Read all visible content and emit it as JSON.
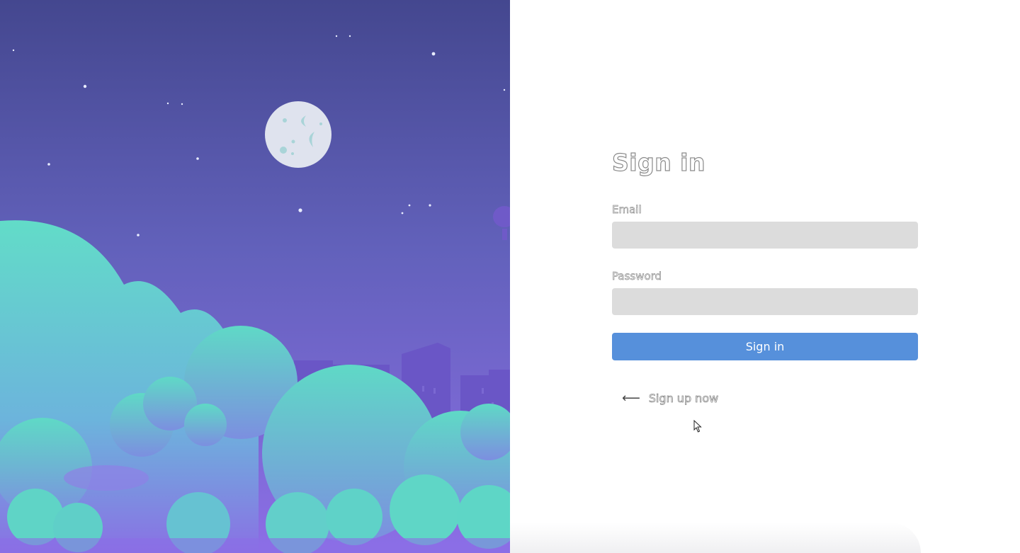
{
  "signin": {
    "title": "Sign in",
    "email_label": "Email",
    "email_value": "",
    "password_label": "Password",
    "password_value": "",
    "submit_label": "Sign in",
    "signup_arrow": "⟵",
    "signup_label": "Sign up now"
  },
  "colors": {
    "sky_top": "#44478f",
    "sky_bottom": "#8a7fe0",
    "cloud": "#5fd8c8",
    "button": "#5690db",
    "input_bg": "#dcdcdc"
  },
  "icons": {
    "arrow": "left-arrow-icon",
    "cursor": "mouse-pointer-icon"
  }
}
